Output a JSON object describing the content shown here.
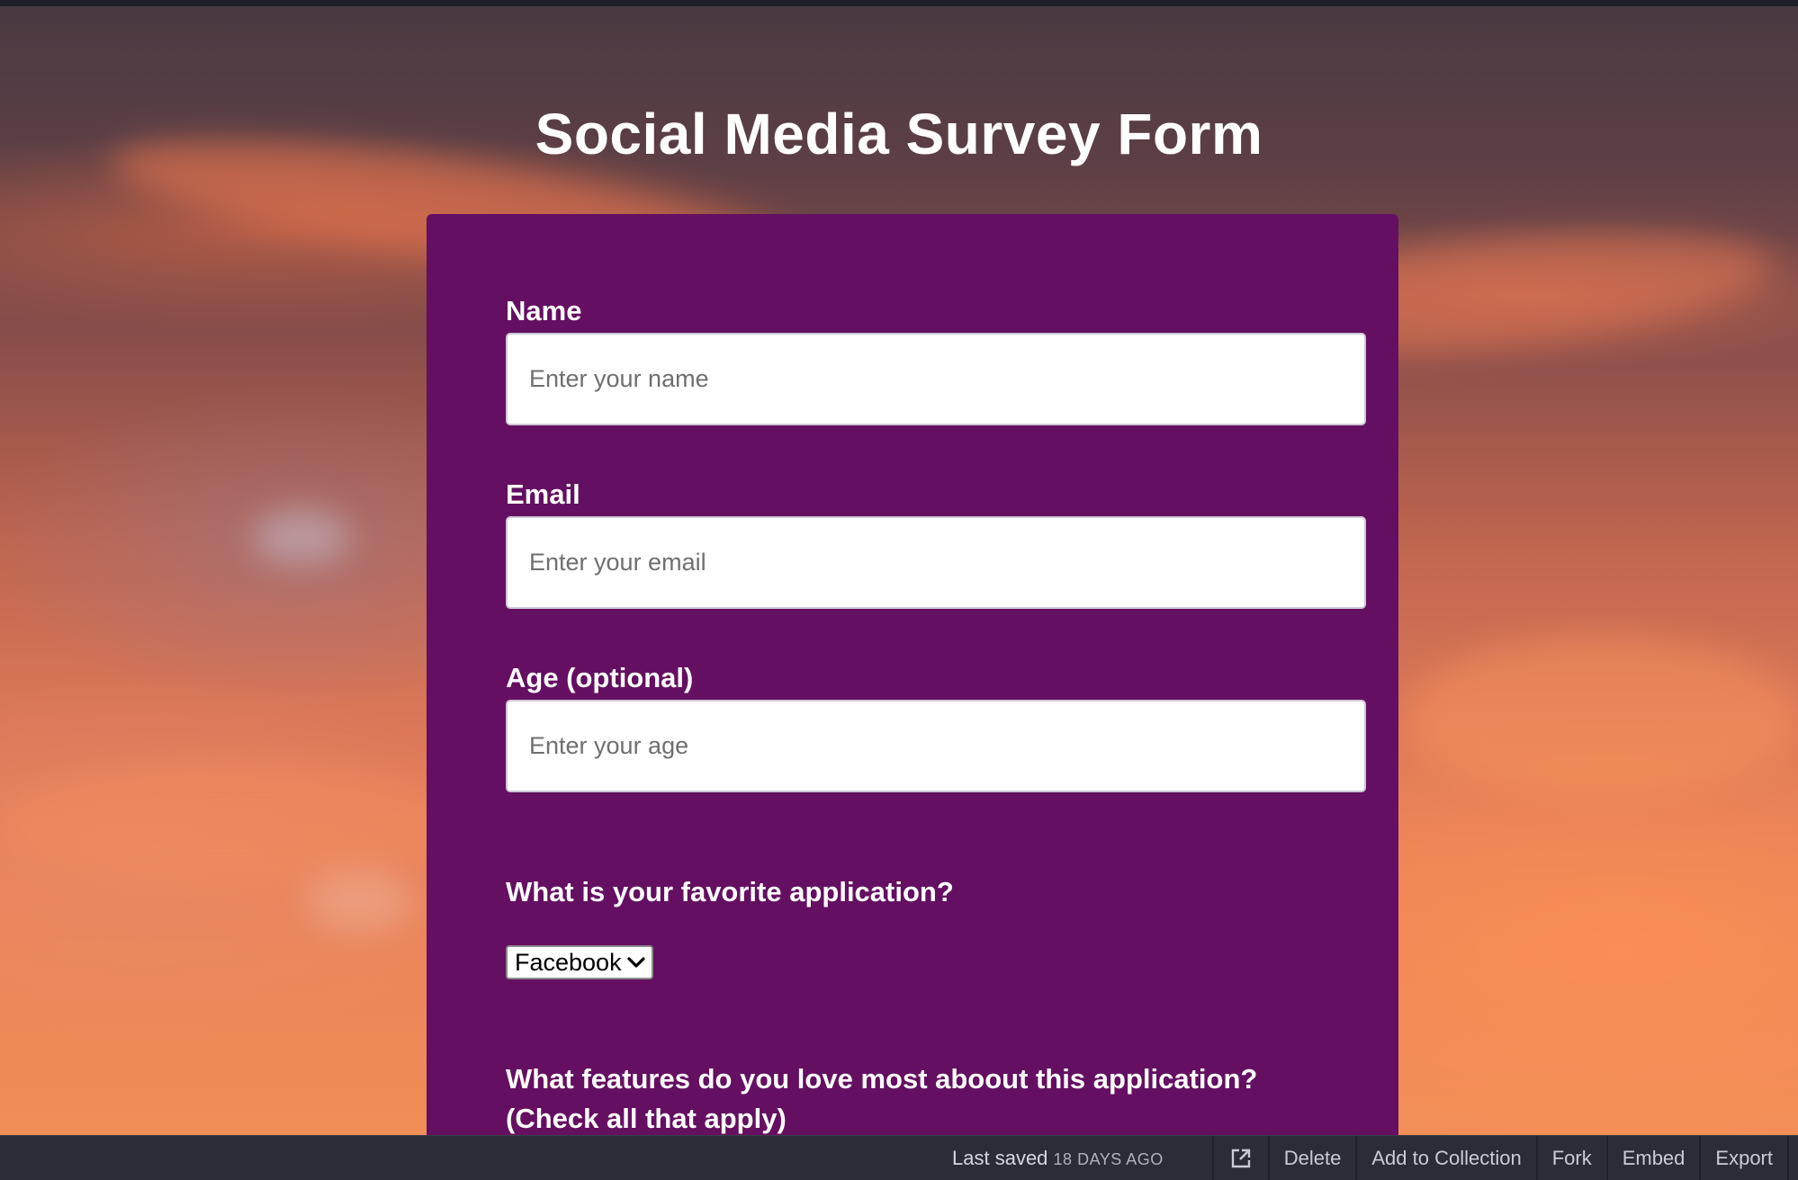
{
  "page": {
    "title": "Social Media Survey Form"
  },
  "form": {
    "name": {
      "label": "Name",
      "placeholder": "Enter your name"
    },
    "email": {
      "label": "Email",
      "placeholder": "Enter your email"
    },
    "age": {
      "label": "Age (optional)",
      "placeholder": "Enter your age"
    },
    "favorite_app": {
      "question": "What is your favorite application?",
      "selected": "Facebook"
    },
    "features": {
      "question_line1": "What features do you love most aboout this application?",
      "question_line2": "(Check all that apply)"
    }
  },
  "editor_bar": {
    "saved_label": "Last saved",
    "saved_ago": "18 DAYS AGO",
    "open_icon": "external-link-icon",
    "delete": "Delete",
    "add_to_collection": "Add to Collection",
    "fork": "Fork",
    "embed": "Embed",
    "export": "Export"
  },
  "colors": {
    "form_background": "#640f61",
    "bottom_bar": "#2a2d35"
  }
}
